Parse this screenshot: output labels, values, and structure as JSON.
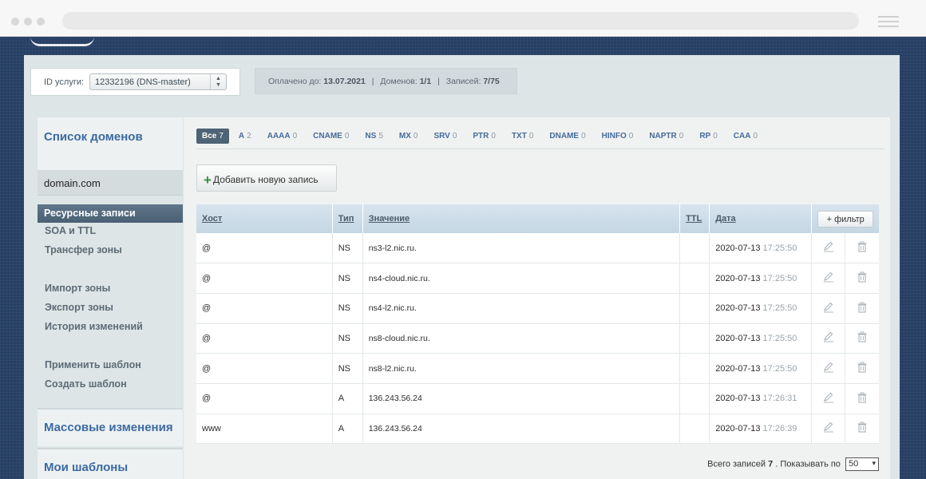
{
  "service": {
    "label": "ID услуги:",
    "selected": "12332196 (DNS-master)",
    "arrows": "▲▼"
  },
  "billing": {
    "paid_label": "Оплачено до:",
    "paid_value": "13.07.2021",
    "domains_label": "Доменов:",
    "domains_value": "1/1",
    "records_label": "Записей:",
    "records_value": "7/75",
    "separator": "|"
  },
  "sidebar": {
    "title": "Список доменов",
    "domain": "domain.com",
    "active_item": "Ресурсные записи",
    "items": [
      "SOA и TTL",
      "Трансфер зоны",
      "Импорт зоны",
      "Экспорт зоны",
      "История изменений",
      "Применить шаблон",
      "Создать шаблон"
    ],
    "footer1": "Массовые изменения",
    "footer2": "Мои шаблоны"
  },
  "type_filters": [
    {
      "label": "Все",
      "count": "7",
      "active": true
    },
    {
      "label": "A",
      "count": "2"
    },
    {
      "label": "AAAA",
      "count": "0"
    },
    {
      "label": "CNAME",
      "count": "0"
    },
    {
      "label": "NS",
      "count": "5"
    },
    {
      "label": "MX",
      "count": "0"
    },
    {
      "label": "SRV",
      "count": "0"
    },
    {
      "label": "PTR",
      "count": "0"
    },
    {
      "label": "TXT",
      "count": "0"
    },
    {
      "label": "DNAME",
      "count": "0"
    },
    {
      "label": "HINFO",
      "count": "0"
    },
    {
      "label": "NAPTR",
      "count": "0"
    },
    {
      "label": "RP",
      "count": "0"
    },
    {
      "label": "CAA",
      "count": "0"
    }
  ],
  "add_button": {
    "icon": "plus-icon",
    "label": "Добавить новую запись"
  },
  "table": {
    "headers": {
      "host": "Хост",
      "type": "Тип",
      "value": "Значение",
      "ttl": "TTL",
      "date": "Дата"
    },
    "filter_button": "+ фильтр",
    "rows": [
      {
        "host": "@",
        "type": "NS",
        "value": "ns3-l2.nic.ru.",
        "ttl": "",
        "date": "2020-07-13",
        "time": "17:25:50"
      },
      {
        "host": "@",
        "type": "NS",
        "value": "ns4-cloud.nic.ru.",
        "ttl": "",
        "date": "2020-07-13",
        "time": "17:25:50"
      },
      {
        "host": "@",
        "type": "NS",
        "value": "ns4-l2.nic.ru.",
        "ttl": "",
        "date": "2020-07-13",
        "time": "17:25:50"
      },
      {
        "host": "@",
        "type": "NS",
        "value": "ns8-cloud.nic.ru.",
        "ttl": "",
        "date": "2020-07-13",
        "time": "17:25:50"
      },
      {
        "host": "@",
        "type": "NS",
        "value": "ns8-l2.nic.ru.",
        "ttl": "",
        "date": "2020-07-13",
        "time": "17:25:50"
      },
      {
        "host": "@",
        "type": "A",
        "value": "136.243.56.24",
        "ttl": "",
        "date": "2020-07-13",
        "time": "17:26:31"
      },
      {
        "host": "www",
        "type": "A",
        "value": "136.243.56.24",
        "ttl": "",
        "date": "2020-07-13",
        "time": "17:26:39"
      }
    ],
    "row_icons": [
      "edit-pencil-icon",
      "trash-icon"
    ]
  },
  "pager": {
    "total_label": "Всего записей",
    "total_value": "7",
    "show_label": ". Показывать по",
    "per_page": "50",
    "per_page_arrow": "▾"
  },
  "colors": {
    "background": "#263f63",
    "panel": "#dde5e6",
    "accent_link": "#3b6aa0",
    "active_tab": "#4f6376"
  }
}
